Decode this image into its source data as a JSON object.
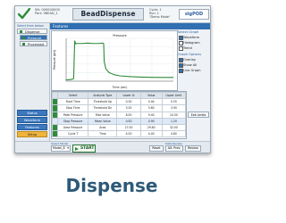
{
  "caption": "Dispense",
  "app": {
    "title": "BeadDispense",
    "brand": "sigPOD",
    "meta_line1": "SN: 000000000",
    "meta_line2": "Part: 9BEAD_1",
    "right_meta_line1": "Cycle: 1",
    "right_meta_line2": "Run: 1",
    "right_meta_line3": "\"Demo Mode\""
  },
  "left_panel": {
    "label": "Select from below",
    "tree": [
      {
        "label": "Dispense",
        "selected": false
      },
      {
        "label": "Pressure",
        "selected": true
      },
      {
        "label": "Processed",
        "selected": false
      }
    ],
    "nav": [
      "Status",
      "Waveform",
      "Features",
      "Setup"
    ]
  },
  "main": {
    "header": "Features"
  },
  "chart_data": {
    "type": "line",
    "title": "Pressure",
    "xlabel": "Time (sec)",
    "ylabel": "Pressure (psi)",
    "grid": true,
    "series": [
      {
        "color": "#2e8b3a",
        "x": [
          0.0,
          0.5,
          0.7,
          0.8,
          0.9,
          1.0,
          1.5,
          2.0,
          2.5,
          3.0,
          3.4,
          3.5,
          3.55,
          3.7,
          4.0,
          4.5,
          5.0,
          6.0,
          7.0,
          8.0,
          9.0,
          10.0
        ],
        "y": [
          0.3,
          0.4,
          0.6,
          9.4,
          8.7,
          8.8,
          8.8,
          8.9,
          8.8,
          8.8,
          8.9,
          8.8,
          4.6,
          2.9,
          2.0,
          1.5,
          1.25,
          1.05,
          0.95,
          0.9,
          0.88,
          0.87
        ]
      }
    ]
  },
  "graph_options": {
    "select_graph_label": "Select Graph",
    "graphs": [
      {
        "label": "Waveform",
        "checked": true
      },
      {
        "label": "Histogram",
        "checked": false
      },
      {
        "label": "Trend",
        "checked": false
      }
    ],
    "graph_options_label": "Graph Options",
    "options": [
      {
        "label": "Overlay",
        "checked": true
      },
      {
        "label": "Show All",
        "checked": true
      },
      {
        "label": "Live Graph",
        "checked": true
      }
    ]
  },
  "table": {
    "columns": [
      "Select",
      "Analysis Type",
      "Lower Lt",
      "Value",
      "Upper Limit"
    ],
    "rows": [
      [
        "Start Time",
        "Threshold Up",
        "0.30",
        "0.44",
        "0.55"
      ],
      [
        "Stop Time",
        "Threshold Dn",
        "3.30",
        "3.60",
        "3.90"
      ],
      [
        "Peak Pressure",
        "Max Value",
        "8.50",
        "9.40",
        "10.00"
      ],
      [
        "Stop Pressure",
        "Mean Value",
        "0.50",
        "0.90",
        "1.20"
      ],
      [
        "Area Pressure",
        "Area",
        "27.00",
        "29.80",
        "32.00"
      ],
      [
        "Cycle T",
        "Time",
        "4.00",
        "4.40",
        "4.80"
      ]
    ],
    "exit_limits": "Exit Limits"
  },
  "bottom": {
    "model_label": "Select Model",
    "model_value": "Model_8",
    "start_label": "START",
    "data_review_label": "Data Review",
    "buttons": [
      "Reset",
      "Alt. Prev.",
      "Review"
    ]
  }
}
